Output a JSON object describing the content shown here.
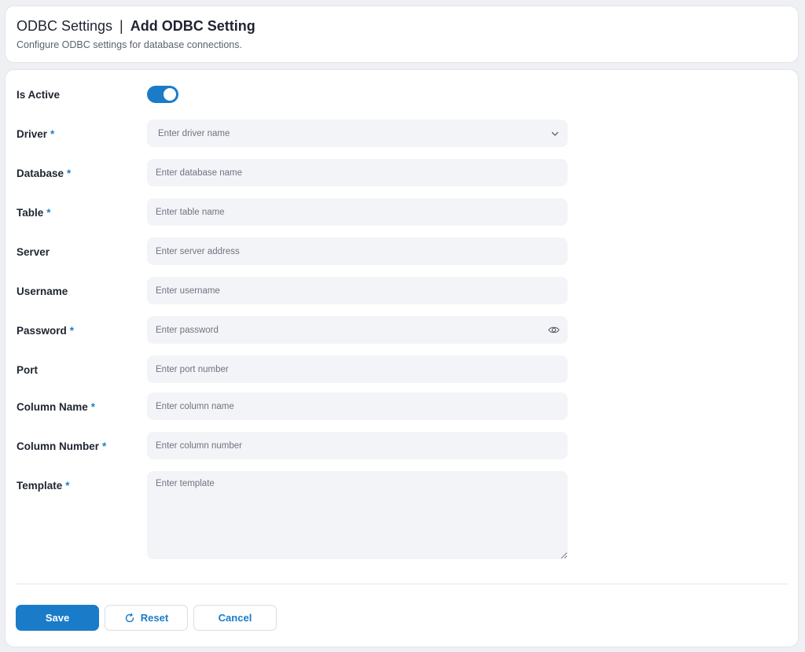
{
  "header": {
    "title": "ODBC Settings",
    "separator": "|",
    "subtitle_title": "Add ODBC Setting",
    "description": "Configure ODBC settings for database connections."
  },
  "form": {
    "is_active": {
      "label": "Is Active",
      "value": true
    },
    "driver": {
      "label": "Driver",
      "required": "*",
      "placeholder": "Enter driver name"
    },
    "database": {
      "label": "Database",
      "required": "*",
      "placeholder": "Enter database name"
    },
    "table": {
      "label": "Table",
      "required": "*",
      "placeholder": "Enter table name"
    },
    "server": {
      "label": "Server",
      "placeholder": "Enter server address"
    },
    "username": {
      "label": "Username",
      "placeholder": "Enter username"
    },
    "password": {
      "label": "Password",
      "required": "*",
      "placeholder": "Enter password"
    },
    "port": {
      "label": "Port",
      "placeholder": "Enter port number"
    },
    "column_name": {
      "label": "Column Name",
      "required": "*",
      "placeholder": "Enter column name"
    },
    "column_number": {
      "label": "Column Number",
      "required": "*",
      "placeholder": "Enter column number"
    },
    "template": {
      "label": "Template",
      "required": "*",
      "placeholder": "Enter template"
    }
  },
  "actions": {
    "save_label": "Save",
    "reset_label": "Reset",
    "cancel_label": "Cancel"
  },
  "colors": {
    "accent": "#1a7cc9",
    "field_bg": "#f3f4f7",
    "page_bg": "#eef0f4"
  },
  "icons": {
    "driver_dropdown": "chevron-down-icon",
    "password_toggle": "eye-icon",
    "reset": "refresh-icon"
  }
}
